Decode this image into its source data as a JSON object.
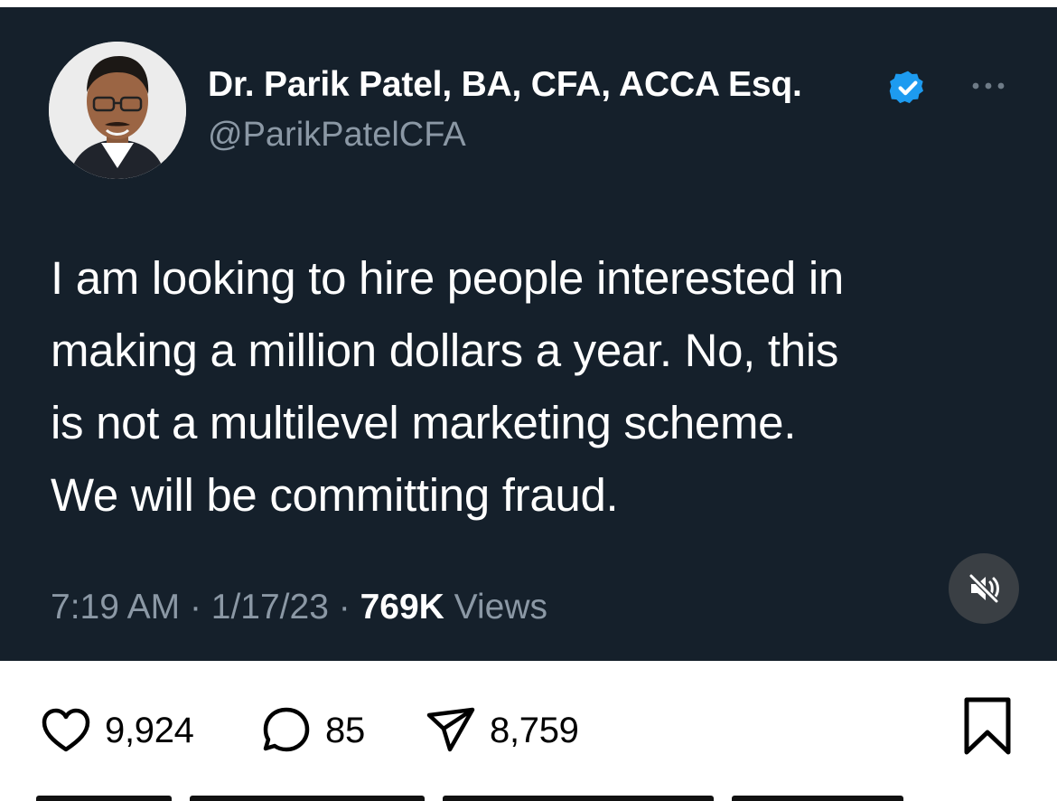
{
  "tweet": {
    "author_name": "Dr. Parik Patel, BA, CFA, ACCA Esq.",
    "handle": "@ParikPatelCFA",
    "verified": true,
    "lines": [
      "I am looking to hire people interested in",
      "making a million dollars a year. No, this",
      "is not a multilevel marketing scheme.",
      "We will be committing fraud."
    ],
    "time": "7:19 AM",
    "separator": "·",
    "date": "1/17/23",
    "views_count": "769K",
    "views_label": "Views"
  },
  "post_actions": {
    "likes": "9,924",
    "comments": "85",
    "shares": "8,759"
  },
  "icons": {
    "verified": "verified-badge-icon",
    "more": "more-options-icon",
    "mute": "muted-speaker-icon",
    "like": "heart-icon",
    "comment": "comment-bubble-icon",
    "share": "paper-plane-icon",
    "bookmark": "bookmark-icon"
  },
  "colors": {
    "tweet_background": "#15202b",
    "verified_blue": "#1d9bf0",
    "secondary_text": "#8b98a5"
  }
}
